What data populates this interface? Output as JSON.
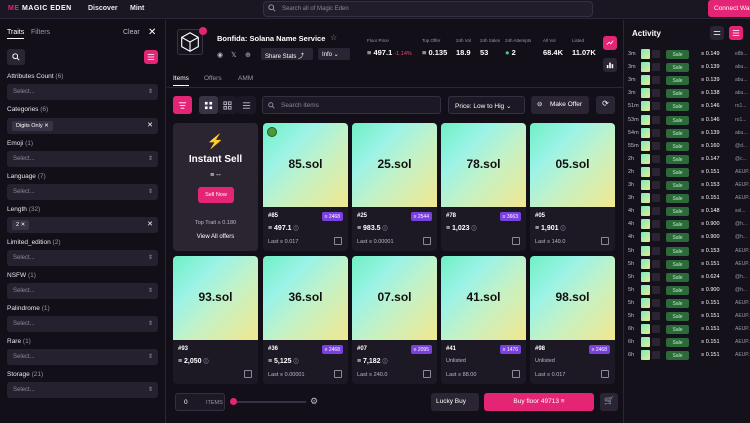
{
  "topbar": {
    "logo_me": "ME",
    "logo_text": "MAGIC EDEN",
    "nav_discover": "Discover",
    "nav_mint": "Mint",
    "search_placeholder": "Search all of Magic Eden",
    "connect": "Connect Wallet"
  },
  "filters": {
    "tab_traits": "Traits",
    "tab_filters": "Filters",
    "clear": "Clear",
    "attributes": [
      {
        "name": "Attributes Count",
        "count": "(6)",
        "placeholder": "Select..."
      },
      {
        "name": "Categories",
        "count": "(6)",
        "chip": "Digits Only"
      },
      {
        "name": "Emoji",
        "count": "(1)",
        "placeholder": "Select..."
      },
      {
        "name": "Language",
        "count": "(7)",
        "placeholder": "Select..."
      },
      {
        "name": "Length",
        "count": "(32)",
        "chip": "2"
      },
      {
        "name": "Limited_edition",
        "count": "(2)",
        "placeholder": "Select..."
      },
      {
        "name": "NSFW",
        "count": "(1)",
        "placeholder": "Select..."
      },
      {
        "name": "Palindrome",
        "count": "(1)",
        "placeholder": "Select..."
      },
      {
        "name": "Rare",
        "count": "(1)",
        "placeholder": "Select..."
      },
      {
        "name": "Storage",
        "count": "(21)",
        "placeholder": "Select..."
      }
    ]
  },
  "collection": {
    "name": "Bonfida: Solana Name Service",
    "share": "Share Stats",
    "info": "Info",
    "stats": [
      {
        "label": "Floor Price",
        "value": "497.1",
        "change": "-1.14%"
      },
      {
        "label": "Top Offer",
        "value": "0.135"
      },
      {
        "label": "24h Vol",
        "value": "18.9"
      },
      {
        "label": "24h Sales",
        "value": "53"
      },
      {
        "label": "24h Attempts",
        "value": "2"
      },
      {
        "label": "All Vol",
        "value": "68.4K"
      },
      {
        "label": "Listed",
        "value": "11.07K"
      }
    ]
  },
  "tabs": {
    "items": "Items",
    "offers": "Offers",
    "amm": "AMM"
  },
  "toolbar": {
    "search_placeholder": "Search items",
    "sort": "Price: Low to Hig",
    "make_offer": "Make Offer"
  },
  "instant_sell": {
    "title": "Instant Sell",
    "price": "≡ --",
    "button": "Sell Now",
    "top_trait": "Top Trait ≡ 0.180",
    "view_all": "View All offers"
  },
  "cards": [
    {
      "name": "85.sol",
      "id": "#85",
      "rank": "≡ 2468",
      "price": "≡ 497.1",
      "last": "Last ≡ 0.017"
    },
    {
      "name": "25.sol",
      "id": "#25",
      "rank": "≡ 2544",
      "price": "≡ 983.5",
      "last": "Last ≡ 0.00001"
    },
    {
      "name": "78.sol",
      "id": "#78",
      "rank": "≡ 3663",
      "price": "≡ 1,023",
      "last": ""
    },
    {
      "name": "05.sol",
      "id": "#05",
      "rank": "",
      "price": "≡ 1,901",
      "last": "Last ≡ 149.0"
    },
    {
      "name": "93.sol",
      "id": "#93",
      "rank": "",
      "price": "≡ 2,050",
      "last": ""
    },
    {
      "name": "36.sol",
      "id": "#36",
      "rank": "≡ 2468",
      "price": "≡ 5,125",
      "last": "Last ≡ 0.00001"
    },
    {
      "name": "07.sol",
      "id": "#07",
      "rank": "≡ 2095",
      "price": "≡ 7,182",
      "last": "Last ≡ 240.0"
    },
    {
      "name": "41.sol",
      "id": "#41",
      "rank": "≡ 1476",
      "price": "Unlisted",
      "last": "Last ≡ 88.00"
    },
    {
      "name": "98.sol",
      "id": "#98",
      "rank": "≡ 2468",
      "price": "Unlisted",
      "last": "Last ≡ 0.017"
    }
  ],
  "bottom": {
    "count": "0",
    "items_label": "ITEMS",
    "lucky": "Lucky Buy",
    "buy_floor": "Buy floor 49713 ≡"
  },
  "activity": {
    "title": "Activity",
    "rows": [
      {
        "t": "3m",
        "type": "Sale",
        "price": "≡ 0.149",
        "user": "e8b..."
      },
      {
        "t": "3m",
        "type": "Sale",
        "price": "≡ 0.139",
        "user": "abu..."
      },
      {
        "t": "3m",
        "type": "Sale",
        "price": "≡ 0.139",
        "user": "abu..."
      },
      {
        "t": "3m",
        "type": "Sale",
        "price": "≡ 0.138",
        "user": "abu..."
      },
      {
        "t": "51m",
        "type": "Sale",
        "price": "≡ 0.146",
        "user": "ro1..."
      },
      {
        "t": "53m",
        "type": "Sale",
        "price": "≡ 0.146",
        "user": "ro1..."
      },
      {
        "t": "54m",
        "type": "Sale",
        "price": "≡ 0.139",
        "user": "abu..."
      },
      {
        "t": "55m",
        "type": "Sale",
        "price": "≡ 0.160",
        "user": "@d..."
      },
      {
        "t": "2h",
        "type": "Sale",
        "price": "≡ 0.147",
        "user": "@c..."
      },
      {
        "t": "2h",
        "type": "Sale",
        "price": "≡ 0.151",
        "user": "AEUP..."
      },
      {
        "t": "3h",
        "type": "Sale",
        "price": "≡ 0.153",
        "user": "AEUP..."
      },
      {
        "t": "3h",
        "type": "Sale",
        "price": "≡ 0.151",
        "user": "AEUP..."
      },
      {
        "t": "4h",
        "type": "Sale",
        "price": "≡ 0.148",
        "user": "sol..."
      },
      {
        "t": "4h",
        "type": "Sale",
        "price": "≡ 0.900",
        "user": "@h..."
      },
      {
        "t": "4h",
        "type": "Sale",
        "price": "≡ 0.900",
        "user": "@h..."
      },
      {
        "t": "5h",
        "type": "Sale",
        "price": "≡ 0.153",
        "user": "AEUP..."
      },
      {
        "t": "5h",
        "type": "Sale",
        "price": "≡ 0.151",
        "user": "AEUP..."
      },
      {
        "t": "5h",
        "type": "Sale",
        "price": "≡ 0.624",
        "user": "@h..."
      },
      {
        "t": "5h",
        "type": "Sale",
        "price": "≡ 0.900",
        "user": "@h..."
      },
      {
        "t": "5h",
        "type": "Sale",
        "price": "≡ 0.151",
        "user": "AEUP..."
      },
      {
        "t": "5h",
        "type": "Sale",
        "price": "≡ 0.151",
        "user": "AEUP..."
      },
      {
        "t": "6h",
        "type": "Sale",
        "price": "≡ 0.151",
        "user": "AEUP..."
      },
      {
        "t": "6h",
        "type": "Sale",
        "price": "≡ 0.151",
        "user": "AEUP..."
      },
      {
        "t": "6h",
        "type": "Sale",
        "price": "≡ 0.151",
        "user": "AEUP..."
      }
    ]
  }
}
